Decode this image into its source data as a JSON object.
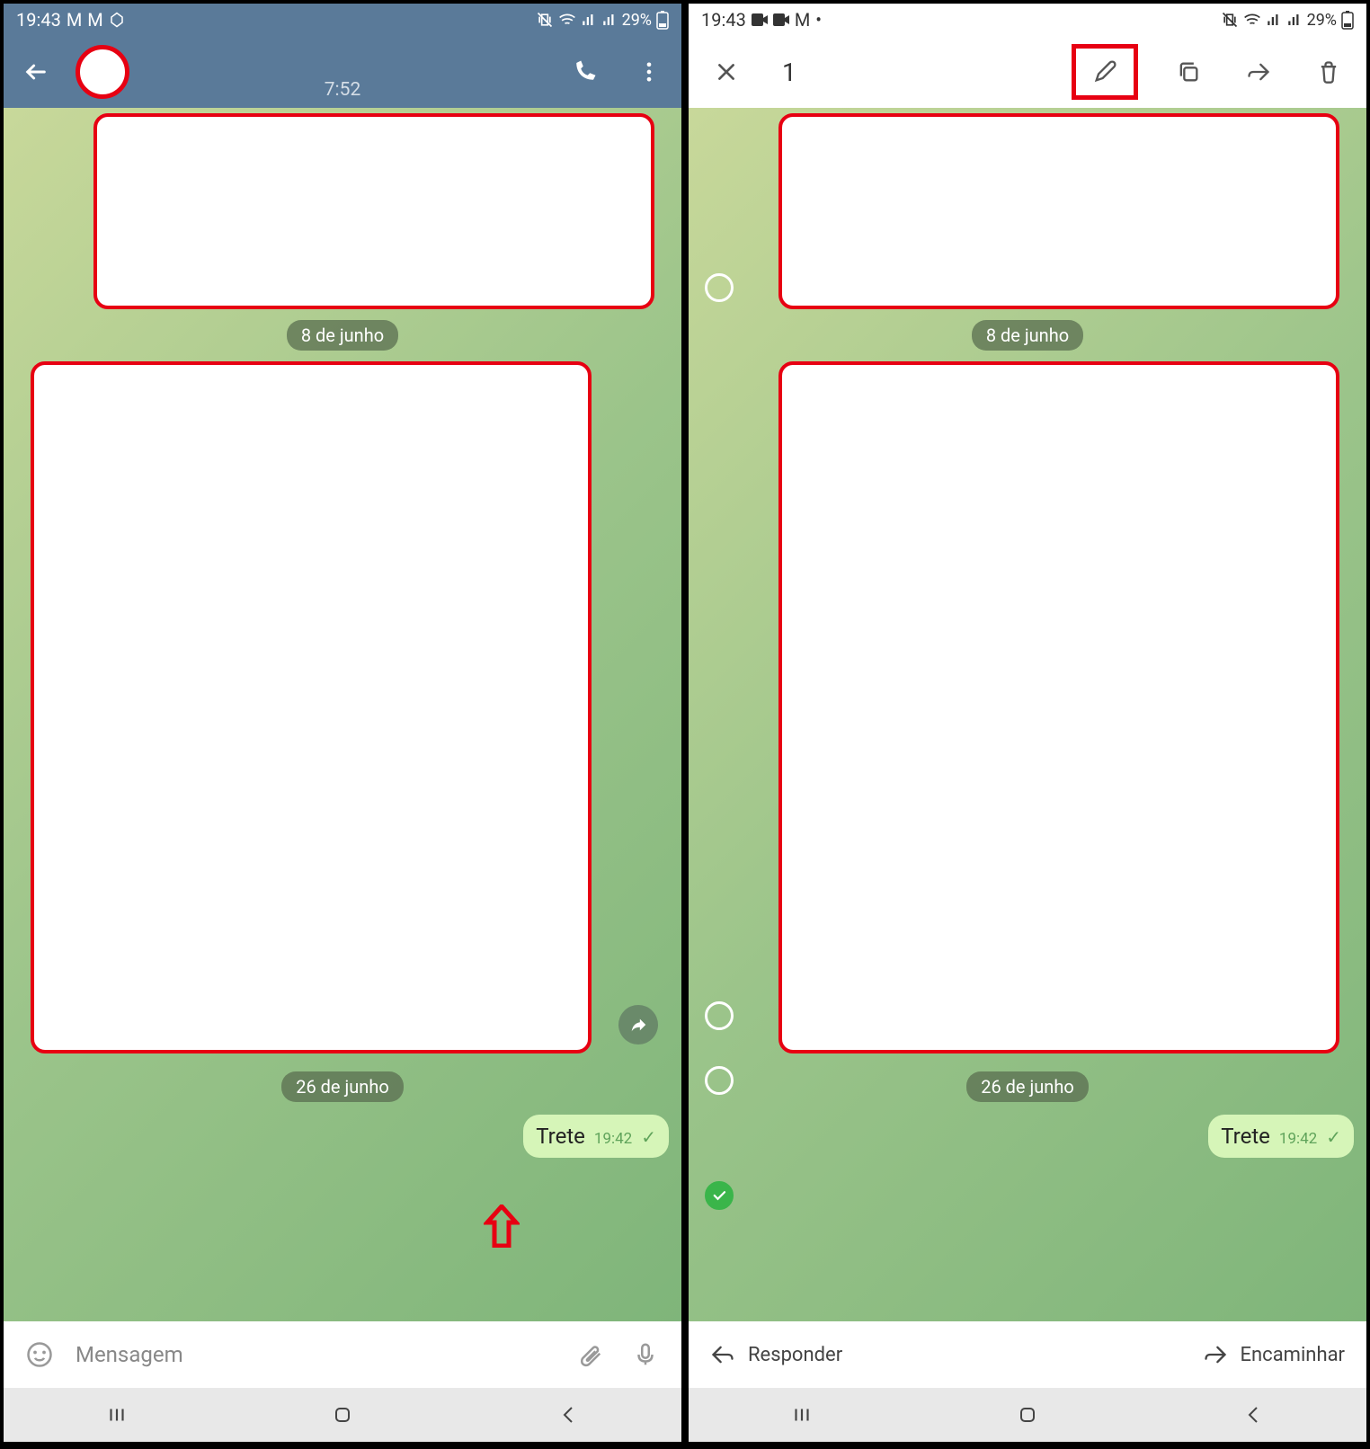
{
  "left": {
    "status": {
      "time": "19:43",
      "battery": "29%"
    },
    "header": {
      "subtitle_time": "7:52"
    },
    "dates": {
      "d1": "8 de junho",
      "d2": "26 de junho"
    },
    "message": {
      "text": "Trete",
      "time": "19:42"
    },
    "input": {
      "placeholder": "Mensagem"
    }
  },
  "right": {
    "status": {
      "time": "19:43",
      "battery": "29%"
    },
    "header": {
      "count": "1"
    },
    "dates": {
      "d1": "8 de junho",
      "d2": "26 de junho"
    },
    "message": {
      "text": "Trete",
      "time": "19:42"
    },
    "actions": {
      "reply": "Responder",
      "forward": "Encaminhar"
    }
  }
}
